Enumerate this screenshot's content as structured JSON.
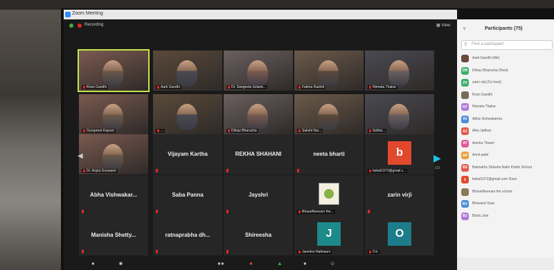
{
  "window": {
    "title": "Zoom Meeting"
  },
  "meeting": {
    "recording_label": "Recording",
    "view_label": "View",
    "page_indicator": "1/3"
  },
  "tiles": [
    {
      "name": "Kiran Gandhi",
      "kind": "video"
    },
    {
      "name": "Aarti Gandhi",
      "kind": "video"
    },
    {
      "name": "Dr. Sangeeta Solank...",
      "kind": "video"
    },
    {
      "name": "Fatima Rashid",
      "kind": "video"
    },
    {
      "name": "Nirmala Thakur",
      "kind": "video"
    },
    {
      "name": "Gurupreet Kapoor",
      "kind": "video"
    },
    {
      "name": "...",
      "kind": "video"
    },
    {
      "name": "Dilnaz Bharucha",
      "kind": "video"
    },
    {
      "name": "Sakshi Nar...",
      "kind": "video"
    },
    {
      "name": "Sethia...",
      "kind": "video"
    },
    {
      "name": "Dr. Anjna Goswami",
      "kind": "video"
    },
    {
      "name": "Vijayam Kartha",
      "kind": "name"
    },
    {
      "name": "REKHA SHAHANI",
      "kind": "name"
    },
    {
      "name": "neeta bharti",
      "kind": "name"
    },
    {
      "name": "bebal1972@gmail.c...",
      "kind": "avatar",
      "letter": "b",
      "color": "#e0492c"
    },
    {
      "name": "Abha Vishwakar...",
      "kind": "name"
    },
    {
      "name": "Saba Panna",
      "kind": "name"
    },
    {
      "name": "Jayshri",
      "kind": "name"
    },
    {
      "name": "BharatNeevam the...",
      "kind": "logo"
    },
    {
      "name": "zarin virji",
      "kind": "name"
    },
    {
      "name": "Manisha Shetty...",
      "kind": "name"
    },
    {
      "name": "ratnaprabha dh...",
      "kind": "name"
    },
    {
      "name": "Shireesha",
      "kind": "name"
    },
    {
      "name": "Jasmine Nathwani",
      "kind": "avatar",
      "letter": "J",
      "color": "#1d8a8a"
    },
    {
      "name": "O.k",
      "kind": "avatar",
      "letter": "O",
      "color": "#1d7c8a"
    }
  ],
  "participants": {
    "title": "Participants (75)",
    "search_placeholder": "Find a participant",
    "items": [
      {
        "name": "Aarti Gandhi (Me)",
        "initials": "",
        "color": "#6b4a3a"
      },
      {
        "name": "Dilnaz Bharucha (Host)",
        "initials": "DB",
        "color": "#3fae6b"
      },
      {
        "name": "zarin virji (Co-host)",
        "initials": "ZV",
        "color": "#3fae6b"
      },
      {
        "name": "Kiran Gandhi",
        "initials": "",
        "color": "#7a6a5a"
      },
      {
        "name": "Nirmala Thakur",
        "initials": "NT",
        "color": "#b07ad8"
      },
      {
        "name": "Abha Vishwakarma",
        "initials": "AV",
        "color": "#4a8ed8"
      },
      {
        "name": "Alka Jadhav",
        "initials": "AJ",
        "color": "#e05a4a"
      },
      {
        "name": "Anisha Thawri",
        "initials": "AT",
        "color": "#e05a9a"
      },
      {
        "name": "Annii patel",
        "initials": "AP",
        "color": "#e8a23a"
      },
      {
        "name": "Balmakhs Shiksha Nathi Public School",
        "initials": "BS",
        "color": "#e05a4a"
      },
      {
        "name": "bebal1972@gmail.com Dave",
        "initials": "b",
        "color": "#e0492c"
      },
      {
        "name": "BharatNeevam the school",
        "initials": "",
        "color": "#8a7a5a"
      },
      {
        "name": "Bhavana Vyas",
        "initials": "BV",
        "color": "#4a8ed8"
      },
      {
        "name": "Bindu Jain",
        "initials": "BJ",
        "color": "#b07ad8"
      }
    ]
  }
}
